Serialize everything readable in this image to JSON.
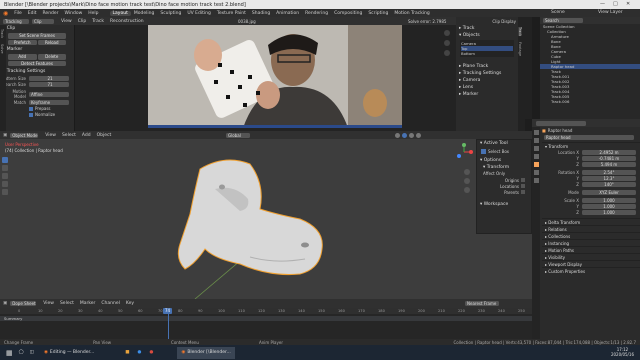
{
  "titlebar": {
    "text": "Blender [\\Blender projects\\Mark\\Dino face motion track test\\Dino face motion track test 2.blend]"
  },
  "menubar": {
    "items": [
      "File",
      "Edit",
      "Render",
      "Window",
      "Help"
    ],
    "tabs": [
      "Layout",
      "Modeling",
      "Sculpting",
      "UV Editing",
      "Texture Paint",
      "Shading",
      "Animation",
      "Rendering",
      "Compositing",
      "Scripting",
      "Motion Tracking"
    ],
    "active_tab": "Layout",
    "scene": "Scene",
    "view_layer": "View Layer"
  },
  "clip_header": {
    "mode": "Tracking",
    "clip": "Clip",
    "menus": [
      "View",
      "Clip",
      "Track",
      "Reconstruction"
    ],
    "solve_error": "Solve error: 2.7985",
    "clip_display": "Clip Display",
    "filename": "0038.jpg"
  },
  "left_panel": {
    "clip_title": "Clip",
    "set_scene_frames": "Set Scene Frames",
    "prefetch": "Prefetch",
    "reload": "Reload",
    "marker_title": "Marker",
    "add": "Add",
    "delete": "Delete",
    "detect_features": "Detect Features",
    "tracking_settings": "Tracking Settings",
    "pattern_size_label": "Pattern Size",
    "pattern_size": "21",
    "search_size_label": "Search Size",
    "search_size": "71",
    "motion_model_label": "Motion Model",
    "motion_model": "Affine",
    "match_label": "Match",
    "match": "Keyframe",
    "prepass": "Prepass",
    "normalize": "Normalize",
    "tabs": [
      "Track",
      "Solve",
      "Stabilization",
      "Annotation"
    ]
  },
  "right_clip": {
    "sections": [
      "Track",
      "Objects"
    ],
    "objects": [
      "Camera",
      "Top",
      "Bottom"
    ],
    "more": [
      "Plane Track",
      "Tracking Settings",
      "Camera",
      "Lens",
      "Marker"
    ],
    "tabs": [
      "Track",
      "Footage",
      "View"
    ]
  },
  "outliner": {
    "title": "Scene Collection",
    "items": [
      "Collection",
      "Armature",
      "Bone",
      "Bone",
      "Camera",
      "Cube",
      "Light",
      "Raptor head",
      "Track",
      "Track.001",
      "Track.002",
      "Track.003",
      "Track.004",
      "Track.005",
      "Track.006"
    ],
    "selected": "Raptor head",
    "search_placeholder": "Search"
  },
  "props": {
    "object_name": "Raptor head",
    "transform": "Transform",
    "location_label": "Location X",
    "loc": [
      "2.4952 m",
      "-0.7481 m",
      "5.494 m"
    ],
    "rotation_label": "Rotation X",
    "rot": [
      "2.54°",
      "12.3°",
      "140°"
    ],
    "mode_label": "Mode",
    "mode": "XYZ Euler",
    "scale_label": "Scale X",
    "scale": [
      "1.000",
      "1.000",
      "1.000"
    ],
    "sections": [
      "Delta Transform",
      "Relations",
      "Collections",
      "Instancing",
      "Motion Paths",
      "Visibility",
      "Viewport Display",
      "Custom Properties"
    ]
  },
  "viewport_header": {
    "mode": "Object Mode",
    "menus": [
      "View",
      "Select",
      "Add",
      "Object"
    ],
    "orientation": "Global"
  },
  "viewport": {
    "view_name": "User Perspective",
    "collection": "(74) Collection | Raptor head"
  },
  "npanel": {
    "active_tool": "Active Tool",
    "select_box": "Select Box",
    "options": "Options",
    "transform": "Transform",
    "affect_only": "Affect Only",
    "origins": "Origins",
    "locations": "Locations",
    "parents": "Parents",
    "workspace": "Workspace",
    "tabs": [
      "Tool",
      "View",
      "Item"
    ]
  },
  "timeline": {
    "mode": "Dope Sheet",
    "menus": [
      "View",
      "Select",
      "Marker",
      "Channel",
      "Key"
    ],
    "filter": "Nearest Frame",
    "ticks": [
      "0",
      "10",
      "20",
      "30",
      "40",
      "50",
      "60",
      "70",
      "80",
      "90",
      "100",
      "110",
      "120",
      "130",
      "140",
      "150",
      "160",
      "170",
      "180",
      "190",
      "200",
      "210",
      "220",
      "230",
      "240",
      "250"
    ],
    "current_frame": "74",
    "summary": "Summary"
  },
  "status": {
    "left": "Change Frame",
    "mid1": "Pan View",
    "mid2": "Context Menu",
    "mid3": "Anim Player",
    "right": "Collection | Raptor head | Verts:43,570 | Faces:87,044 | Tris:174,088 | Objects:1/13 | 2.82.7"
  },
  "taskbar": {
    "items": [
      "Editing — Blender...",
      "Blender [\\Blender..."
    ],
    "time": "17:12",
    "date": "2020/05/16"
  }
}
